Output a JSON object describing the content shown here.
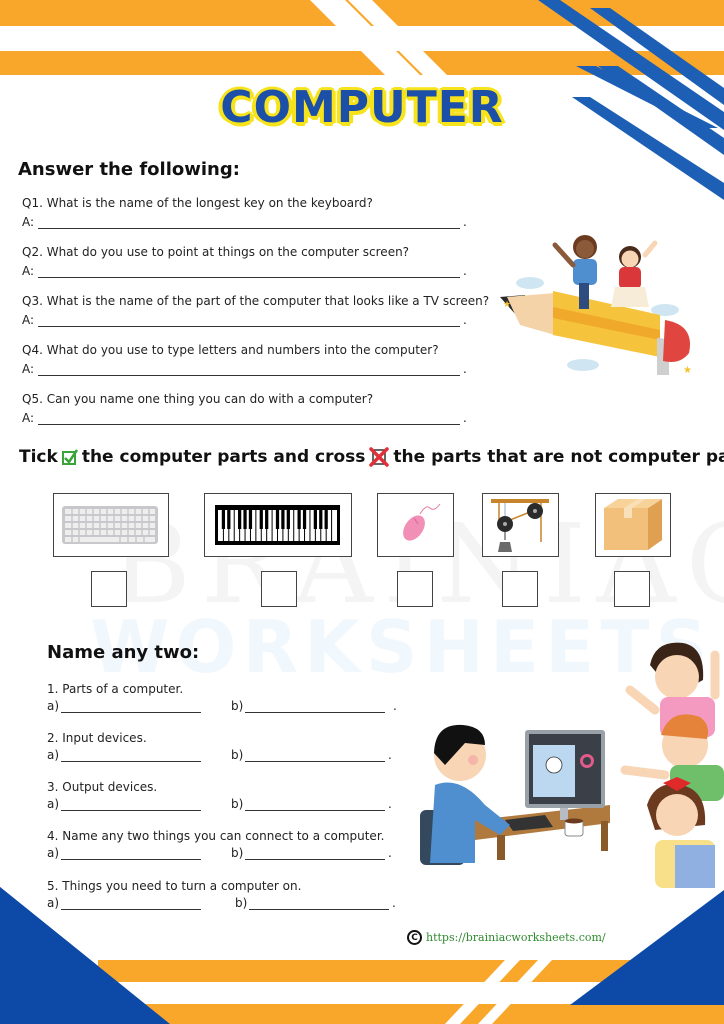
{
  "colors": {
    "orange": "#f9a72b",
    "blue": "#1d5fb5",
    "dark_blue": "#0d4aa8",
    "title_fill": "#1b4fa8",
    "title_outline": "#f7e31b",
    "link_green": "#2f8a2f"
  },
  "header": {
    "title": "COMPUTER"
  },
  "watermark": {
    "line1": "BRAINIAC",
    "line2": "WORKSHEETS"
  },
  "section1": {
    "heading": "Answer the following:",
    "answer_prefix": "A:",
    "questions": [
      {
        "text": "Q1. What is the name of the longest key on the keyboard?",
        "answer": ""
      },
      {
        "text": "Q2. What do you use to point at things on the computer screen?",
        "answer": ""
      },
      {
        "text": "Q3. What is the name of the part of the computer that looks like a TV screen?",
        "answer": ""
      },
      {
        "text": "Q4. What do you use to type letters and numbers into the computer?",
        "answer": ""
      },
      {
        "text": "Q5. Can you name one thing you can do with a computer?",
        "answer": ""
      }
    ],
    "illustration": "kids-riding-pencil"
  },
  "section2": {
    "heading_part1": "Tick",
    "heading_part2": "the computer parts and cross",
    "heading_part3": "the parts that are not computer parts:",
    "tick_icon": "green-checkbox-icon",
    "cross_icon": "red-cross-icon",
    "items": [
      {
        "name": "keyboard",
        "icon": "keyboard-icon",
        "checked": false
      },
      {
        "name": "piano keyboard",
        "icon": "piano-icon",
        "checked": false
      },
      {
        "name": "mouse",
        "icon": "mouse-icon",
        "checked": false
      },
      {
        "name": "pulley",
        "icon": "pulley-icon",
        "checked": false
      },
      {
        "name": "cardboard box",
        "icon": "box-icon",
        "checked": false
      }
    ]
  },
  "section3": {
    "heading": "Name any two:",
    "label_a": "a)",
    "label_b": "b)",
    "questions": [
      {
        "text": "1. Parts of a computer.",
        "a": "",
        "b": ""
      },
      {
        "text": "2. Input devices.",
        "a": "",
        "b": ""
      },
      {
        "text": "3. Output devices.",
        "a": "",
        "b": ""
      },
      {
        "text": "4. Name any two things you can connect to a computer.",
        "a": "",
        "b": ""
      },
      {
        "text": "5. Things you need to turn a computer on.",
        "a": "",
        "b": ""
      }
    ],
    "illustration": "kids-at-computer"
  },
  "footer": {
    "copyright_symbol": "C",
    "url": "https://brainiacworksheets.com/"
  }
}
